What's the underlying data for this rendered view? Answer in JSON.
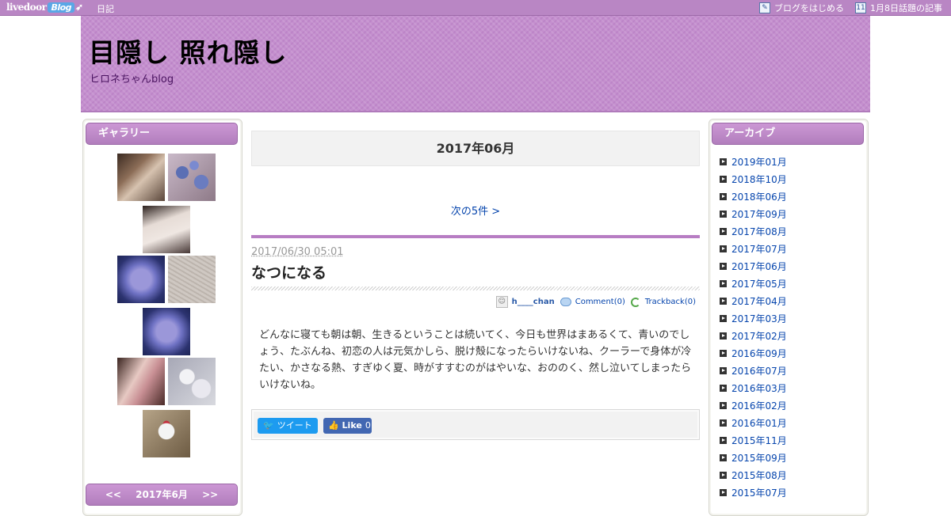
{
  "topbar": {
    "logo_main": "livedoor",
    "logo_blog": "Blog",
    "nav_diary": "日記",
    "start_blog": "ブログをはじめる",
    "topic": "1月8日話題の記事",
    "calendar_day": "11"
  },
  "header": {
    "title": "目隠し 照れ隠し",
    "subtitle": "ヒロネちゃんblog"
  },
  "gallery": {
    "heading": "ギャラリー"
  },
  "calendar": {
    "prev": "<<",
    "month": "2017年6月",
    "next": ">>"
  },
  "archive": {
    "heading": "アーカイブ",
    "items": [
      "2019年01月",
      "2018年10月",
      "2018年06月",
      "2017年09月",
      "2017年08月",
      "2017年07月",
      "2017年06月",
      "2017年05月",
      "2017年04月",
      "2017年03月",
      "2017年02月",
      "2016年09月",
      "2016年07月",
      "2016年03月",
      "2016年02月",
      "2016年01月",
      "2015年11月",
      "2015年09月",
      "2015年08月",
      "2015年07月"
    ]
  },
  "main": {
    "month_title": "2017年06月",
    "next_link": "次の5件 >"
  },
  "article": {
    "date": "2017/06/30 05:01",
    "title": "なつになる",
    "author": "h____chan",
    "comment": "Comment(0)",
    "trackback": "Trackback(0)",
    "body": "どんなに寝ても朝は朝、生きるということは続いてく、今日も世界はまあるくて、青いのでしょう、たぶんね、初恋の人は元気かしら、脱け殻になったらいけないね、クーラーで身体が冷たい、かさなる熱、すぎゆく夏、時がすすむのがはやいな、おののく、然し泣いてしまったらいけないね。",
    "tweet": "ツイート",
    "like": "Like",
    "like_count": "0"
  }
}
